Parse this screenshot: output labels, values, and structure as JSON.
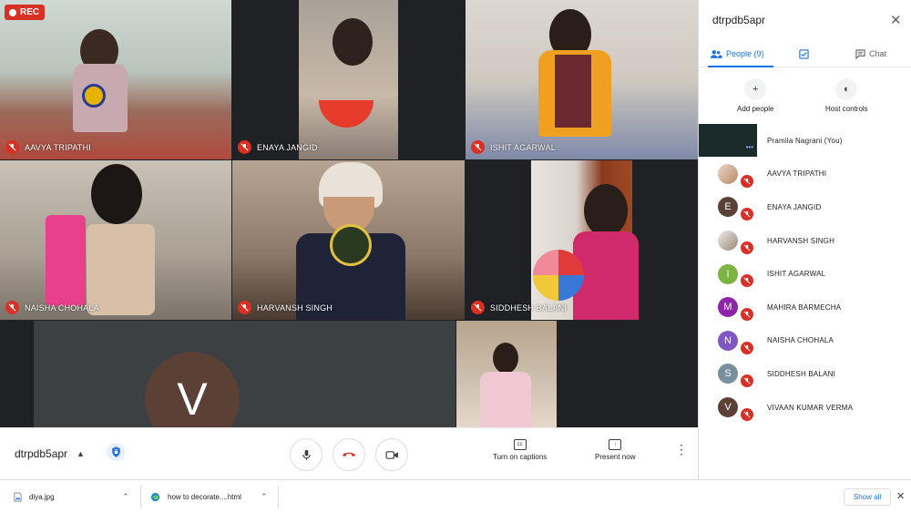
{
  "recording": {
    "label": "REC"
  },
  "tiles": [
    {
      "name": "AAVYA TRIPATHI",
      "mic": "muted"
    },
    {
      "name": "ENAYA JANGID",
      "mic": "muted"
    },
    {
      "name": "ISHIT AGARWAL",
      "mic": "muted"
    },
    {
      "name": "NAISHA CHOHALA",
      "mic": "muted"
    },
    {
      "name": "HARVANSH SINGH",
      "mic": "muted"
    },
    {
      "name": "SIDDHESH BALANI",
      "mic": "muted"
    }
  ],
  "presenter_tile": {
    "initial": "V",
    "color": "#5b4036"
  },
  "bottom_bar": {
    "meeting_code": "dtrpdb5apr",
    "captions_label": "Turn on captions",
    "present_label": "Present now",
    "end_call_color": "#d93025"
  },
  "panel": {
    "title": "dtrpdb5apr",
    "tabs": {
      "people": "People (9)",
      "chat": "Chat"
    },
    "add_people": "Add people",
    "host_controls": "Host controls",
    "participants": [
      {
        "name": "Pramila Nagrani (You)",
        "avatar": "self-video"
      },
      {
        "name": "AAVYA TRIPATHI",
        "avatar": "photo"
      },
      {
        "name": "ENAYA JANGID",
        "initial": "E",
        "color": "#5b4036"
      },
      {
        "name": "HARVANSH SINGH",
        "avatar": "photo"
      },
      {
        "name": "ISHIT AGARWAL",
        "initial": "I",
        "color": "#7cb342"
      },
      {
        "name": "MAHIRA BARMECHA",
        "initial": "M",
        "color": "#8e24aa"
      },
      {
        "name": "NAISHA CHOHALA",
        "initial": "N",
        "color": "#7e57c2"
      },
      {
        "name": "SIDDHESH BALANI",
        "initial": "S",
        "color": "#78909c"
      },
      {
        "name": "VIVAAN KUMAR VERMA",
        "initial": "V",
        "color": "#5b4036"
      }
    ]
  },
  "downloads": {
    "items": [
      {
        "filename": "diya.jpg"
      },
      {
        "filename": "how to decorate....html"
      }
    ],
    "show_all": "Show all"
  }
}
